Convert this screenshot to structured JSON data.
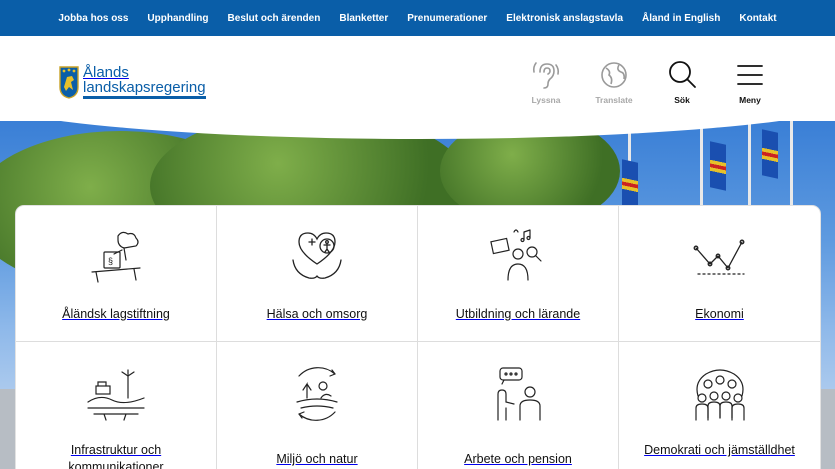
{
  "topnav": [
    "Jobba hos oss",
    "Upphandling",
    "Beslut och ärenden",
    "Blanketter",
    "Prenumerationer",
    "Elektronisk anslagstavla",
    "Åland in English",
    "Kontakt"
  ],
  "logo": {
    "line1": "Ålands",
    "line2": "landskapsregering"
  },
  "tools": {
    "listen": "Lyssna",
    "translate": "Translate",
    "search": "Sök",
    "menu": "Meny"
  },
  "tiles": [
    {
      "label": "Åländsk lagstiftning",
      "icon": "legislation-icon"
    },
    {
      "label": "Hälsa och omsorg",
      "icon": "health-icon"
    },
    {
      "label": "Utbildning och lärande",
      "icon": "education-icon"
    },
    {
      "label": "Ekonomi",
      "icon": "economy-icon"
    },
    {
      "label": "Infrastruktur och kommunikationer",
      "icon": "infrastructure-icon"
    },
    {
      "label": "Miljö och natur",
      "icon": "environment-icon"
    },
    {
      "label": "Arbete och pension",
      "icon": "work-icon"
    },
    {
      "label": "Demokrati och jämställdhet",
      "icon": "democracy-icon"
    }
  ],
  "colors": {
    "brand": "#0a5ea8"
  }
}
